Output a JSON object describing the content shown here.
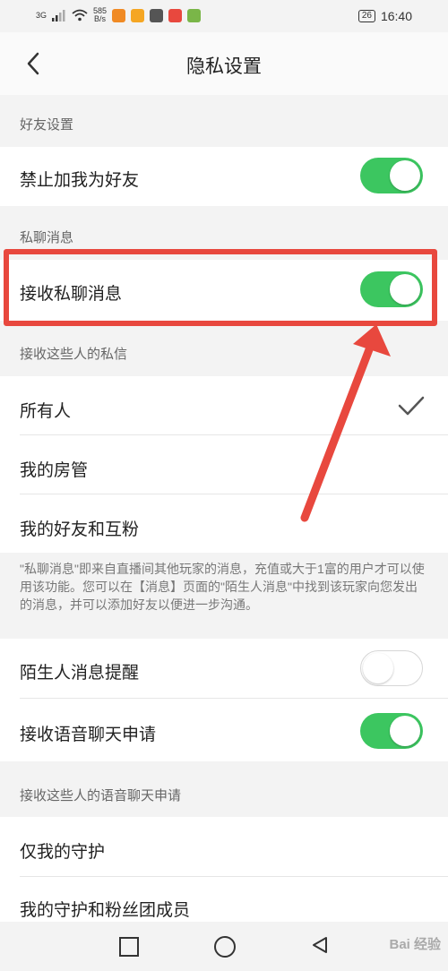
{
  "status_bar": {
    "network": "3G",
    "speed_value": "585",
    "speed_unit": "B/s",
    "battery": "26",
    "time": "16:40",
    "app_icon_colors": [
      "#f08a24",
      "#f5a623",
      "#555555",
      "#e8483e",
      "#7ab648"
    ]
  },
  "header": {
    "title": "隐私设置",
    "back_icon": "chevron-left-icon"
  },
  "sections": {
    "friends": "好友设置",
    "private_msg": "私聊消息",
    "receive_from": "接收这些人的私信",
    "voice_from": "接收这些人的语音聊天申请"
  },
  "rows": {
    "block_friend": {
      "label": "禁止加我为好友",
      "on": true
    },
    "receive_private": {
      "label": "接收私聊消息",
      "on": true
    },
    "everyone": {
      "label": "所有人",
      "checked": true
    },
    "my_managers": {
      "label": "我的房管"
    },
    "friends_mutual": {
      "label": "我的好友和互粉"
    },
    "stranger_alert": {
      "label": "陌生人消息提醒",
      "on": false
    },
    "voice_request": {
      "label": "接收语音聊天申请",
      "on": true
    },
    "only_guardians": {
      "label": "仅我的守护"
    },
    "guardians_fans": {
      "label": "我的守护和粉丝团成员"
    }
  },
  "note": "\"私聊消息\"即来自直播间其他玩家的消息，充值或大于1富的用户才可以使用该功能。您可以在【消息】页面的\"陌生人消息\"中找到该玩家向您发出的消息，并可以添加好友以便进一步沟通。",
  "watermark": "Bai 经验",
  "colors": {
    "toggle_on": "#3cc660",
    "highlight": "#e8483e",
    "background": "#f3f3f3"
  }
}
